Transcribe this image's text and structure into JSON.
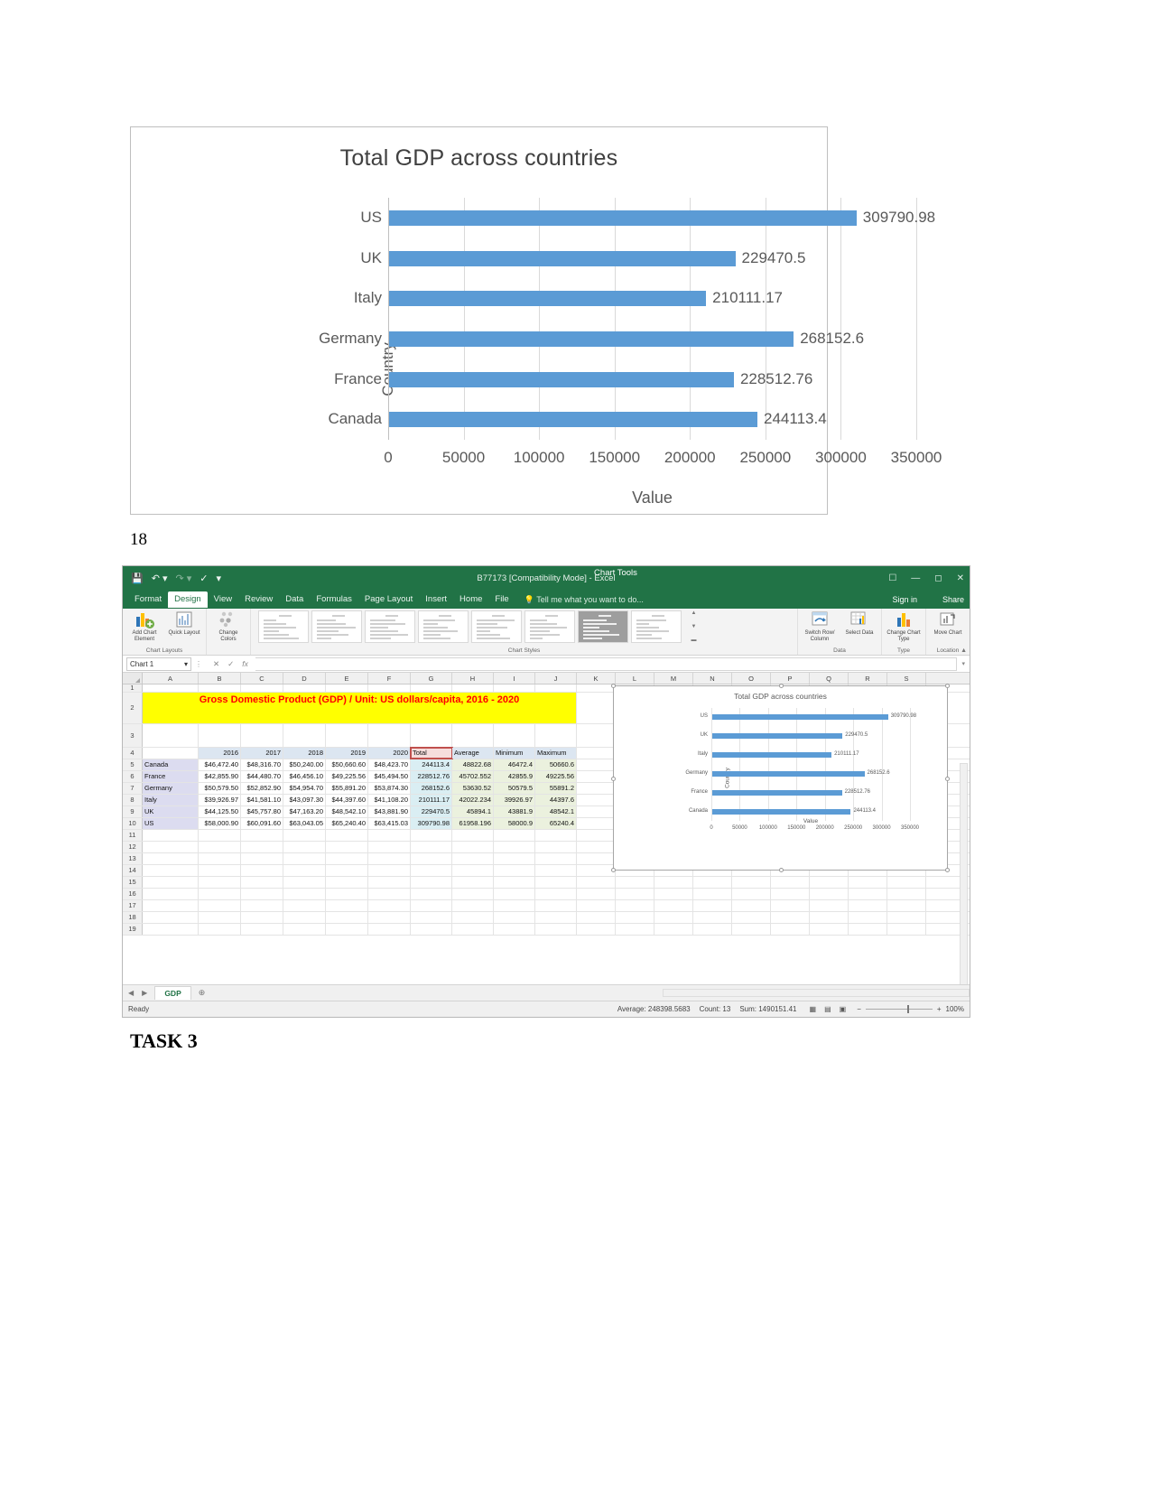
{
  "document": {
    "page_number": "18",
    "task_label": "TASK 3"
  },
  "figure": {
    "title": "Total GDP across countries",
    "xlabel": "Value",
    "ylabel": "Country"
  },
  "chart_data": {
    "type": "bar",
    "orientation": "horizontal",
    "title": "Total GDP across countries",
    "xlabel": "Value",
    "ylabel": "Country",
    "categories": [
      "US",
      "UK",
      "Italy",
      "Germany",
      "France",
      "Canada"
    ],
    "values": [
      309790.98,
      229470.5,
      210111.17,
      268152.6,
      228512.76,
      244113.4
    ],
    "data_labels": [
      "309790.98",
      "229470.5",
      "210111.17",
      "268152.6",
      "228512.76",
      "244113.4"
    ],
    "xticks": [
      "0",
      "50000",
      "100000",
      "150000",
      "200000",
      "250000",
      "300000",
      "350000"
    ],
    "xtick_values": [
      0,
      50000,
      100000,
      150000,
      200000,
      250000,
      300000,
      350000
    ],
    "xlim": [
      0,
      350000
    ],
    "grid": true,
    "legend": "none",
    "bar_color": "#5b9bd5"
  },
  "excel": {
    "titlebar": {
      "filename": "B77173  [Compatibility Mode] - Excel",
      "context_tab_group": "Chart Tools",
      "quick_access": [
        "save-icon",
        "undo-icon",
        "redo-icon",
        "spelling-icon",
        "customize-icon"
      ],
      "window_buttons": [
        "ribbon-display-options",
        "minimize",
        "restore",
        "close"
      ]
    },
    "tabs": [
      {
        "label": "File",
        "active": false
      },
      {
        "label": "Home",
        "active": false
      },
      {
        "label": "Insert",
        "active": false
      },
      {
        "label": "Page Layout",
        "active": false
      },
      {
        "label": "Formulas",
        "active": false
      },
      {
        "label": "Data",
        "active": false
      },
      {
        "label": "Review",
        "active": false
      },
      {
        "label": "View",
        "active": false
      },
      {
        "label": "Design",
        "active": true
      },
      {
        "label": "Format",
        "active": false
      }
    ],
    "tell_me": "Tell me what you want to do...",
    "sign_in": "Sign in",
    "share": "Share",
    "ribbon": {
      "groups": [
        {
          "name": "Chart Layouts",
          "buttons": [
            {
              "label": "Add Chart Element",
              "icon": "add-chart-element-icon"
            },
            {
              "label": "Quick Layout",
              "icon": "quick-layout-icon"
            }
          ]
        },
        {
          "name": "",
          "buttons": [
            {
              "label": "Change Colors",
              "icon": "change-colors-icon"
            }
          ]
        },
        {
          "name": "Chart Styles",
          "buttons": []
        },
        {
          "name": "Data",
          "buttons": [
            {
              "label": "Switch Row/ Column",
              "icon": "switch-row-column-icon"
            },
            {
              "label": "Select Data",
              "icon": "select-data-icon"
            }
          ]
        },
        {
          "name": "Type",
          "buttons": [
            {
              "label": "Change Chart Type",
              "icon": "change-chart-type-icon"
            }
          ]
        },
        {
          "name": "Location",
          "buttons": [
            {
              "label": "Move Chart",
              "icon": "move-chart-icon"
            }
          ]
        }
      ],
      "style_count": 8,
      "selected_style_index": 6
    },
    "formula_bar": {
      "name_box": "Chart 1",
      "formula": "",
      "cancel_icon": "cancel-icon",
      "enter_icon": "enter-icon",
      "function_icon": "insert-function-icon"
    },
    "grid": {
      "columns": [
        "A",
        "B",
        "C",
        "D",
        "E",
        "F",
        "G",
        "H",
        "I",
        "J",
        "K",
        "L",
        "M",
        "N",
        "O",
        "P",
        "Q",
        "R",
        "S"
      ],
      "row_numbers": [
        "1",
        "2",
        "3",
        "4",
        "5",
        "6",
        "7",
        "8",
        "9",
        "10",
        "11",
        "12",
        "13",
        "14",
        "15",
        "16",
        "17",
        "18",
        "19"
      ],
      "banner": "Gross Domestic Product (GDP) / Unit: US dollars/capita, 2016 - 2020",
      "headers": [
        "",
        "2016",
        "2017",
        "2018",
        "2019",
        "2020",
        "Total",
        "Average",
        "Minimum",
        "Maximum"
      ],
      "rows": [
        {
          "row": "5",
          "country": "Canada",
          "y2016": "$46,472.40",
          "y2017": "$48,316.70",
          "y2018": "$50,240.00",
          "y2019": "$50,660.60",
          "y2020": "$48,423.70",
          "total": "244113.4",
          "average": "48822.68",
          "minimum": "46472.4",
          "maximum": "50660.6"
        },
        {
          "row": "6",
          "country": "France",
          "y2016": "$42,855.90",
          "y2017": "$44,480.70",
          "y2018": "$46,456.10",
          "y2019": "$49,225.56",
          "y2020": "$45,494.50",
          "total": "228512.76",
          "average": "45702.552",
          "minimum": "42855.9",
          "maximum": "49225.56"
        },
        {
          "row": "7",
          "country": "Germany",
          "y2016": "$50,579.50",
          "y2017": "$52,852.90",
          "y2018": "$54,954.70",
          "y2019": "$55,891.20",
          "y2020": "$53,874.30",
          "total": "268152.6",
          "average": "53630.52",
          "minimum": "50579.5",
          "maximum": "55891.2"
        },
        {
          "row": "8",
          "country": "Italy",
          "y2016": "$39,926.97",
          "y2017": "$41,581.10",
          "y2018": "$43,097.30",
          "y2019": "$44,397.60",
          "y2020": "$41,108.20",
          "total": "210111.17",
          "average": "42022.234",
          "minimum": "39926.97",
          "maximum": "44397.6"
        },
        {
          "row": "9",
          "country": "UK",
          "y2016": "$44,125.50",
          "y2017": "$45,757.80",
          "y2018": "$47,163.20",
          "y2019": "$48,542.10",
          "y2020": "$43,881.90",
          "total": "229470.5",
          "average": "45894.1",
          "minimum": "43881.9",
          "maximum": "48542.1"
        },
        {
          "row": "10",
          "country": "US",
          "y2016": "$58,000.90",
          "y2017": "$60,091.60",
          "y2018": "$63,043.05",
          "y2019": "$65,240.40",
          "y2020": "$63,415.03",
          "total": "309790.98",
          "average": "61958.196",
          "minimum": "58000.9",
          "maximum": "65240.4"
        }
      ]
    },
    "embedded_chart": {
      "title": "Total GDP across countries",
      "xlabel": "Value",
      "ylabel": "Country",
      "categories": [
        "US",
        "UK",
        "Italy",
        "Germany",
        "France",
        "Canada"
      ],
      "values": [
        309790.98,
        229470.5,
        210111.17,
        268152.6,
        228512.76,
        244113.4
      ],
      "data_labels": [
        "309790.98",
        "229470.5",
        "210111.17",
        "268152.6",
        "228512.76",
        "244113.4"
      ],
      "xticks": [
        "0",
        "50000",
        "100000",
        "150000",
        "200000",
        "250000",
        "300000",
        "350000"
      ]
    },
    "sheet_tabs": {
      "active": "GDP",
      "add_label": "+"
    },
    "status_bar": {
      "mode": "Ready",
      "average": "Average: 248398.5683",
      "count": "Count: 13",
      "sum": "Sum: 1490151.41",
      "zoom": "100%",
      "views": [
        "normal-view-icon",
        "page-layout-icon",
        "page-break-icon"
      ]
    }
  }
}
